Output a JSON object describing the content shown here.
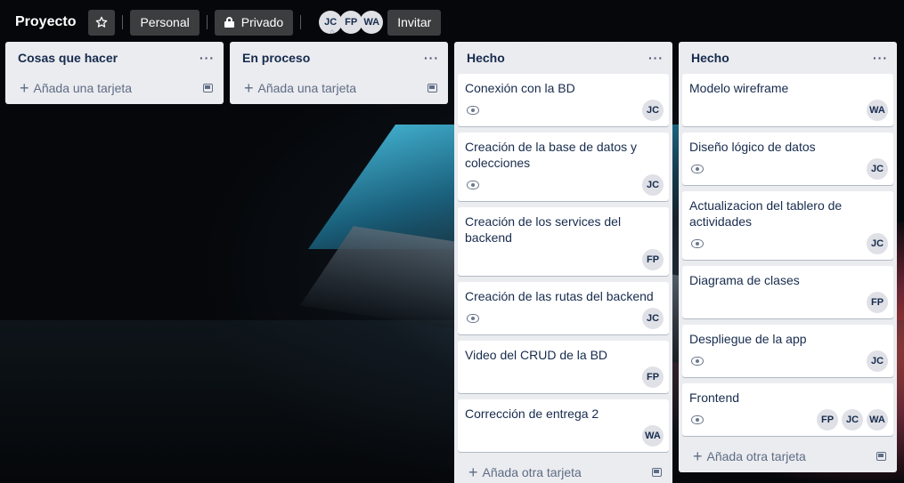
{
  "board": {
    "title": "Proyecto",
    "workspace_label": "Personal",
    "visibility_label": "Privado",
    "invite_label": "Invitar",
    "members": [
      "JC",
      "FP",
      "WA"
    ]
  },
  "lists": [
    {
      "title": "Cosas que hacer",
      "add_label": "Añada una tarjeta",
      "cards": []
    },
    {
      "title": "En proceso",
      "add_label": "Añada una tarjeta",
      "cards": []
    },
    {
      "title": "Hecho",
      "add_label": "Añada otra tarjeta",
      "cards": [
        {
          "title": "Conexión con la BD",
          "watch": true,
          "members": [
            "JC"
          ]
        },
        {
          "title": "Creación de la base de datos y colecciones",
          "watch": true,
          "members": [
            "JC"
          ]
        },
        {
          "title": "Creación de los services del backend",
          "watch": false,
          "members": [
            "FP"
          ]
        },
        {
          "title": "Creación de las rutas del backend",
          "watch": true,
          "members": [
            "JC"
          ]
        },
        {
          "title": "Video del CRUD de la BD",
          "watch": false,
          "members": [
            "FP"
          ]
        },
        {
          "title": "Corrección de entrega 2",
          "watch": false,
          "members": [
            "WA"
          ]
        }
      ]
    },
    {
      "title": "Hecho",
      "add_label": "Añada otra tarjeta",
      "cards": [
        {
          "title": "Modelo wireframe",
          "watch": false,
          "members": [
            "WA"
          ]
        },
        {
          "title": "Diseño lógico de datos",
          "watch": true,
          "members": [
            "JC"
          ]
        },
        {
          "title": "Actualizacion del tablero de actividades",
          "watch": true,
          "members": [
            "JC"
          ]
        },
        {
          "title": "Diagrama de clases",
          "watch": false,
          "members": [
            "FP"
          ]
        },
        {
          "title": "Despliegue de la app",
          "watch": true,
          "members": [
            "JC"
          ]
        },
        {
          "title": "Frontend",
          "watch": true,
          "members": [
            "FP",
            "JC",
            "WA"
          ]
        }
      ]
    }
  ]
}
